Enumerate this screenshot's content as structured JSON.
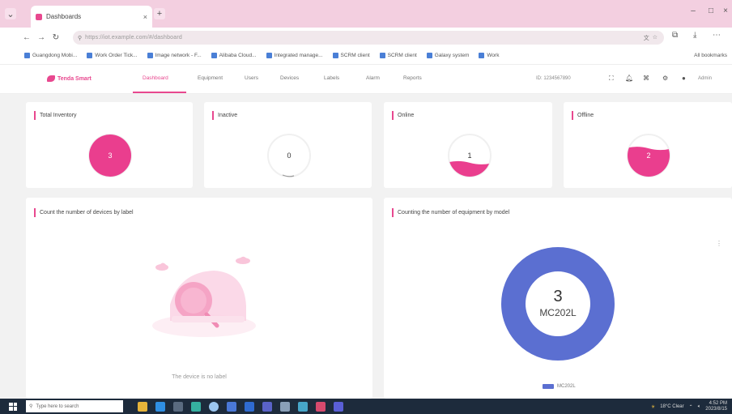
{
  "browser": {
    "tab_title": "Dashboards",
    "url": "https://iot.example.com/#/dashboard",
    "bookmarks": [
      "Guangdong Mobi...",
      "Work Order Tick...",
      "Image network - F...",
      "Alibaba Cloud...",
      "Integrated manage...",
      "SCRM client",
      "SCRM client",
      "Galaxy system",
      "Work"
    ],
    "other_bookmarks": "All bookmarks"
  },
  "app": {
    "logo_text": "Tenda Smart",
    "menu": [
      "Dashboard",
      "Equipment",
      "Users",
      "Devices",
      "Labels",
      "Alarm",
      "Reports"
    ],
    "active_menu_index": 0,
    "header_right_text": "ID: 1234567890",
    "header_user": "Admin"
  },
  "cards": {
    "total": {
      "title": "Total Inventory",
      "value": "3",
      "fill": 1.0,
      "color": "#ea3e8e"
    },
    "inactive": {
      "title": "Inactive",
      "value": "0",
      "fill": 0.0,
      "color": "#ea3e8e"
    },
    "online": {
      "title": "Online",
      "value": "1",
      "fill": 0.33,
      "color": "#ea3e8e"
    },
    "offline": {
      "title": "Offline",
      "value": "2",
      "fill": 0.67,
      "color": "#ea3e8e"
    }
  },
  "panels": {
    "labels": {
      "title": "Count the number of devices by label",
      "empty_text": "The device is no label"
    },
    "models": {
      "title": "Counting the number of equipment by model",
      "center_value": "3",
      "center_label": "MC202L",
      "legend": "MC202L",
      "donut_color": "#5b6fd1"
    }
  },
  "taskbar": {
    "search_placeholder": "Type here to search",
    "weather": "18°C Clear",
    "time": "4:52 PM",
    "date": "2023/8/15"
  }
}
